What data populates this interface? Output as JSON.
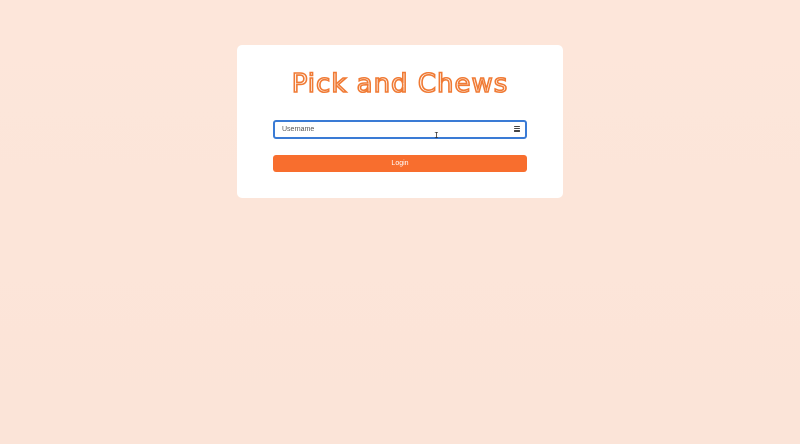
{
  "app": {
    "logo_text": "Pick and Chews"
  },
  "login": {
    "username_placeholder": "Username",
    "username_value": "",
    "submit_label": "Login",
    "autofill_icon": "autofill-menu-icon",
    "cursor_icon": "text-cursor-icon"
  },
  "colors": {
    "background": "#fde6da",
    "accent": "#f86e2e",
    "focus_border": "#3a7bd5",
    "card": "#ffffff"
  }
}
